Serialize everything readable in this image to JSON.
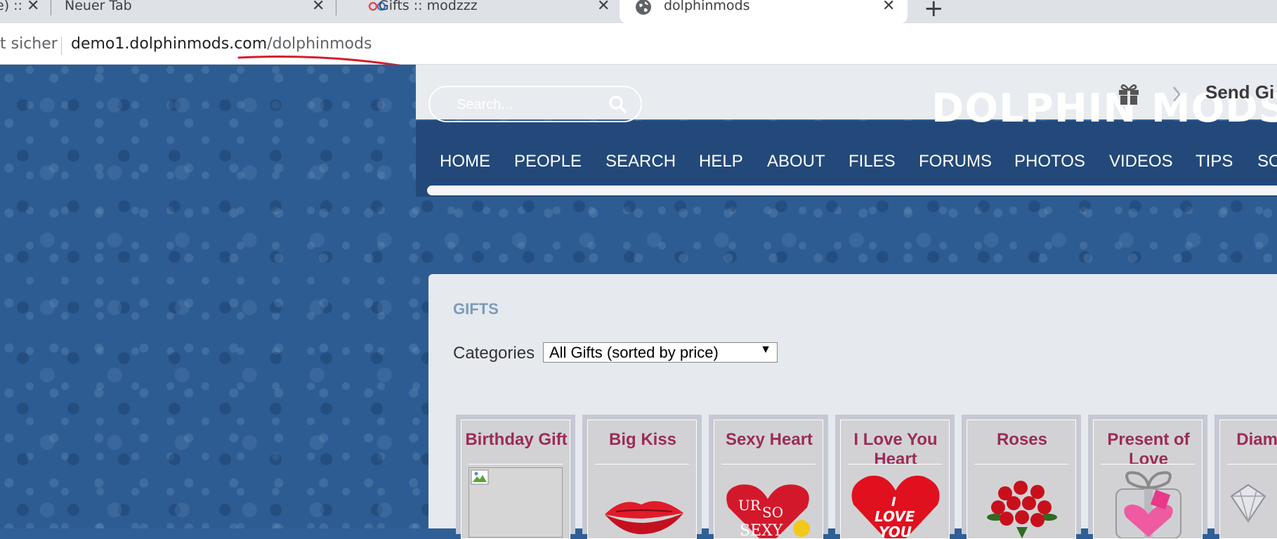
{
  "browser": {
    "tabs": [
      {
        "title": "e) ::",
        "active": false
      },
      {
        "title": "Neuer Tab",
        "active": false
      },
      {
        "title": "Gifts :: modzzz",
        "active": false
      },
      {
        "title": "dolphinmods",
        "active": true
      }
    ],
    "new_tab_glyph": "+",
    "close_glyph": "✕",
    "security_text": "t sicher",
    "url_host": "demo1.dolphinmods.com",
    "url_path": "/dolphinmods"
  },
  "header": {
    "search_placeholder": "Search...",
    "logo_text": "DOLPHIN MODS",
    "send_gift": "Send Gi"
  },
  "nav": {
    "items": [
      "HOME",
      "PEOPLE",
      "SEARCH",
      "HELP",
      "ABOUT",
      "FILES",
      "FORUMS",
      "PHOTOS",
      "VIDEOS",
      "TIPS",
      "SO"
    ]
  },
  "gifts": {
    "heading": "GIFTS",
    "categories_label": "Categories",
    "selected_category": "All Gifts (sorted by price)",
    "cards": [
      {
        "title": "Birthday Gift",
        "image": "broken-image-icon"
      },
      {
        "title": "Big Kiss",
        "image": "lips-image"
      },
      {
        "title": "Sexy Heart",
        "image": "sexy-heart-image",
        "image_text": [
          "UR",
          "SO",
          "SEXY"
        ]
      },
      {
        "title": "I Love You Heart",
        "image": "love-heart-image",
        "image_text": [
          "I",
          "LOVE",
          "YOU"
        ]
      },
      {
        "title": "Roses",
        "image": "roses-image"
      },
      {
        "title": "Present of Love",
        "image": "present-image"
      },
      {
        "title": "Diam Hea",
        "image": "diamond-image"
      }
    ]
  },
  "colors": {
    "gift_title": "#9b2c58",
    "nav_bg": "#23497a",
    "page_bg": "#2d5c93",
    "heading": "#7b9bbb"
  }
}
